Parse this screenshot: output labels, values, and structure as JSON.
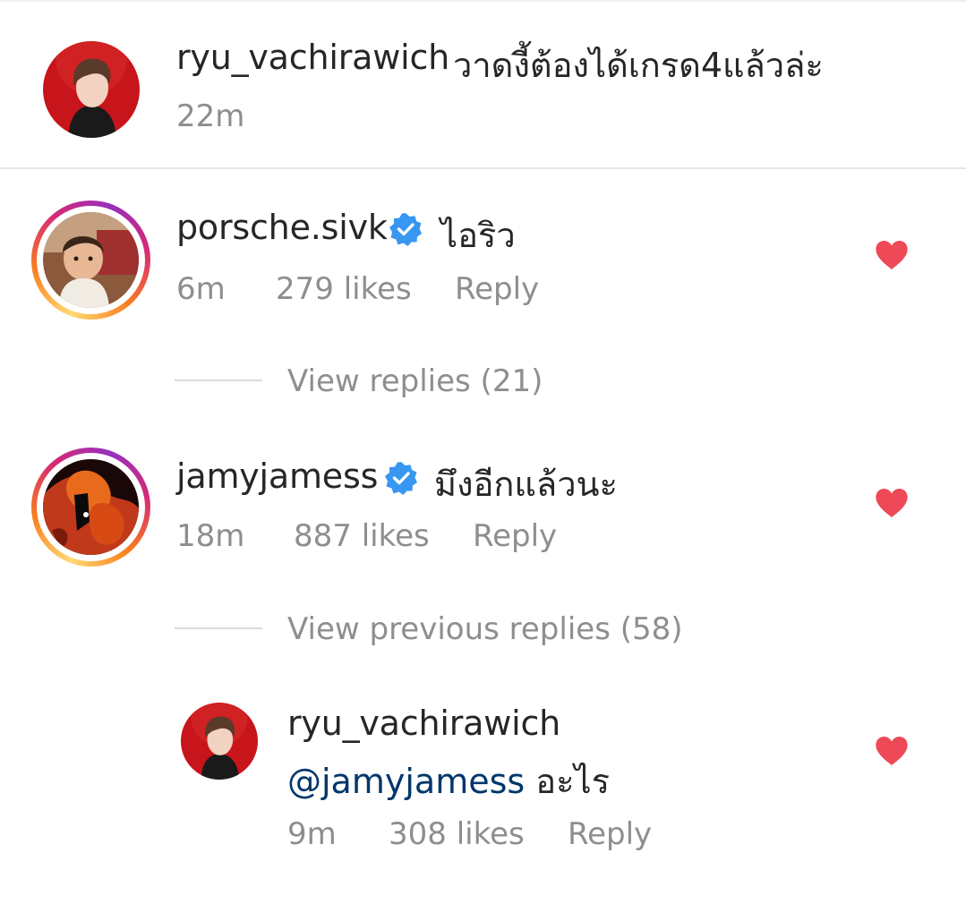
{
  "caption": {
    "username": "ryu_vachirawich",
    "text": "วาดงี้ต้องได้เกรด4แล้วล่ะ",
    "time": "22m"
  },
  "comments": [
    {
      "username": "porsche.sivk",
      "verified": true,
      "text": "ไอริว",
      "time": "6m",
      "likes": "279 likes",
      "reply_label": "Reply",
      "liked": true,
      "view_replies": "View replies (21)"
    },
    {
      "username": "jamyjamess",
      "verified": true,
      "text": "มึงอีกแล้วนะ",
      "time": "18m",
      "likes": "887 likes",
      "reply_label": "Reply",
      "liked": true,
      "view_replies": "View previous replies (58)"
    }
  ],
  "reply": {
    "username": "ryu_vachirawich",
    "mention": "@jamyjamess",
    "text": "อะไร",
    "time": "9m",
    "likes": "308 likes",
    "reply_label": "Reply",
    "liked": true
  },
  "colors": {
    "heart": "#ed4956",
    "verified": "#3897f0",
    "meta": "#8e8e8e",
    "mention": "#00376b"
  }
}
